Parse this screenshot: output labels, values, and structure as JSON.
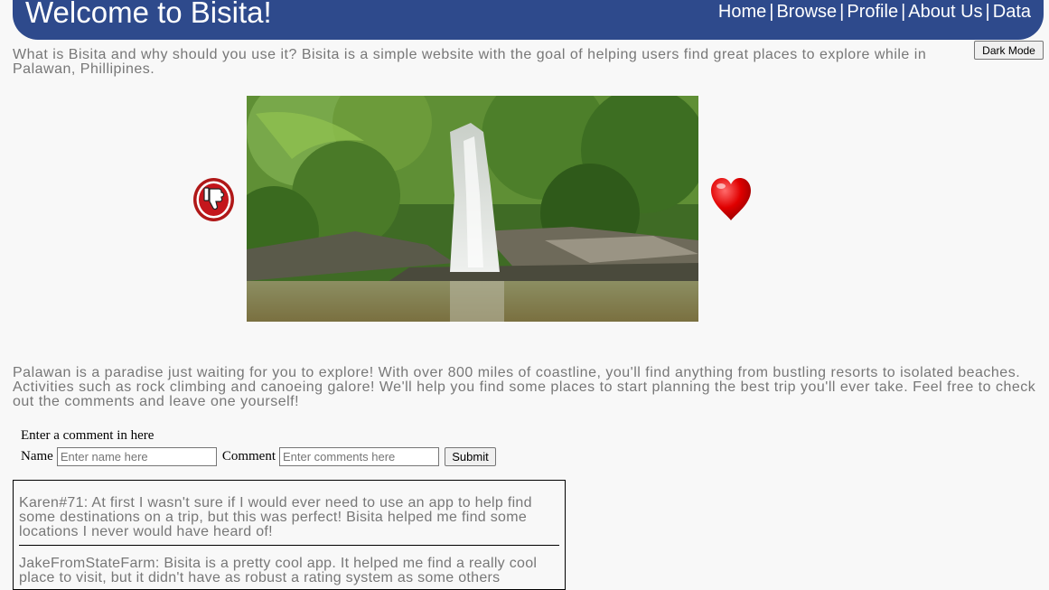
{
  "header": {
    "title": "Welcome to Bisita!",
    "nav": [
      {
        "label": "Home"
      },
      {
        "label": "Browse"
      },
      {
        "label": "Profile"
      },
      {
        "label": "About Us"
      },
      {
        "label": "Data"
      }
    ],
    "separator": "|"
  },
  "dark_mode_label": "Dark Mode",
  "intro": "What is Bisita and why should you use it? Bisita is a simple website with the goal of helping users find great places to explore while in Palawan, Phillipines.",
  "gallery": {
    "dislike_icon": "thumbs-down-icon",
    "like_icon": "heart-icon",
    "image": "waterfall-photo"
  },
  "paragraph": "Palawan is a paradise just waiting for you to explore! With over 800 miles of coastline, you'll find anything from bustling resorts to isolated beaches. Activities such as rock climbing and canoeing galore! We'll help you find some places to start planning the best trip you'll ever take. Feel free to check out the comments and leave one yourself!",
  "form": {
    "heading": "Enter a comment in here",
    "name_label": "Name",
    "name_placeholder": "Enter name here",
    "comment_label": "Comment",
    "comment_placeholder": "Enter comments here",
    "submit_label": "Submit"
  },
  "comments": [
    {
      "text": "Karen#71: At first I wasn't sure if I would ever need to use an app to help find some destinations on a trip, but this was perfect! Bisita helped me find some locations I never would have heard of!"
    },
    {
      "text": "JakeFromStateFarm: Bisita is a pretty cool app. It helped me find a really cool place to visit, but it didn't have as robust a rating system as some others"
    }
  ],
  "colors": {
    "header_bg": "#2e4a8c",
    "text_muted": "#777777",
    "page_bg": "#f8f8f8"
  }
}
